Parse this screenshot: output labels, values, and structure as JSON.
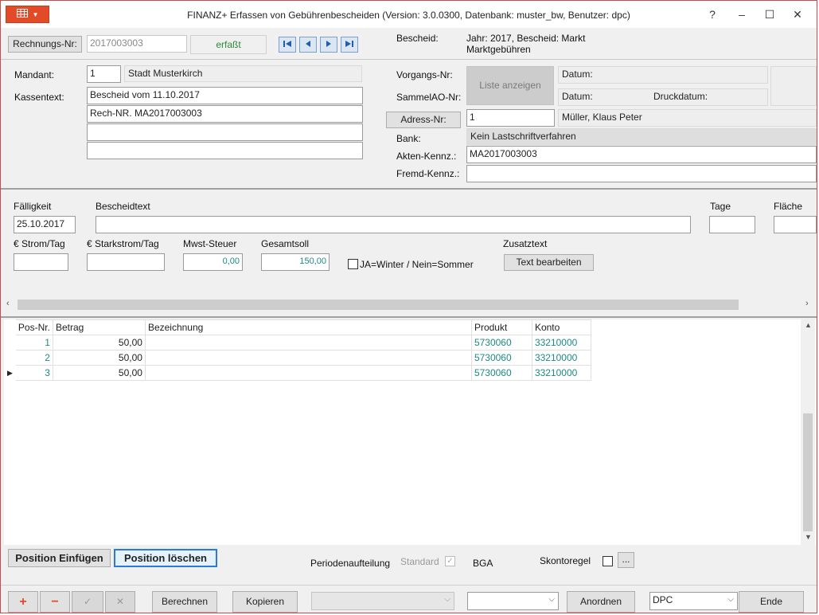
{
  "window": {
    "title": "FINANZ+ Erfassen von Gebührenbescheiden (Version: 3.0.0300, Datenbank: muster_bw, Benutzer: dpc)",
    "help": "?",
    "minimize": "–",
    "maximize": "☐",
    "close": "✕"
  },
  "header": {
    "rechnungs_label": "Rechnungs-Nr:",
    "rechnungs_value": "2017003003",
    "status": "erfaßt",
    "bescheid_label": "Bescheid:",
    "bescheid_line1": "Jahr: 2017, Bescheid: Markt",
    "bescheid_line2": "Marktgebühren"
  },
  "form": {
    "mandant_label": "Mandant:",
    "mandant_nr": "1",
    "mandant_name": "Stadt Musterkirch",
    "kassentext_label": "Kassentext:",
    "kassentext": [
      "Bescheid vom 11.10.2017",
      "Rech-NR. MA2017003003",
      "",
      ""
    ],
    "vorgangs_label": "Vorgangs-Nr:",
    "sammel_label": "SammelAO-Nr:",
    "liste_button": "Liste anzeigen",
    "datum1_label": "Datum:",
    "datum2_label": "Datum:",
    "druckdatum_label": "Druckdatum:",
    "adress_button": "Adress-Nr:",
    "adress_nr": "1",
    "adress_name": "Müller, Klaus Peter",
    "bank_label": "Bank:",
    "bank_value": "Kein Lastschriftverfahren",
    "akten_label": "Akten-Kennz.:",
    "akten_value": "MA2017003003",
    "fremd_label": "Fremd-Kennz.:",
    "fremd_value": ""
  },
  "details": {
    "faelligkeit_label": "Fälligkeit",
    "faelligkeit_value": "25.10.2017",
    "bescheidtext_label": "Bescheidtext",
    "bescheidtext_value": "",
    "tage_label": "Tage",
    "flaeche_label": "Fläche",
    "strom_label": "€ Strom/Tag",
    "starkstrom_label": "€ Starkstrom/Tag",
    "mwst_label": "Mwst-Steuer",
    "mwst_value": "0,00",
    "gesamtsoll_label": "Gesamtsoll",
    "gesamtsoll_value": "150,00",
    "winter_label": "JA=Winter / Nein=Sommer",
    "zusatztext_label": "Zusatztext",
    "text_bearbeiten": "Text bearbeiten"
  },
  "table": {
    "columns": [
      "Pos-Nr.",
      "Betrag",
      "Bezeichnung",
      "Produkt",
      "Konto"
    ],
    "rows": [
      {
        "pos": "1",
        "betrag": "50,00",
        "bezeichnung": "",
        "produkt": "5730060",
        "konto": "33210000"
      },
      {
        "pos": "2",
        "betrag": "50,00",
        "bezeichnung": "",
        "produkt": "5730060",
        "konto": "33210000"
      },
      {
        "pos": "3",
        "betrag": "50,00",
        "bezeichnung": "",
        "produkt": "5730060",
        "konto": "33210000"
      }
    ]
  },
  "footer": {
    "einfuegen": "Position Einfügen",
    "loeschen": "Position löschen",
    "periodenaufteilung": "Periodenaufteilung",
    "standard": "Standard",
    "bga": "BGA",
    "skontoregel": "Skontoregel",
    "dots": "...",
    "plus": "+",
    "minus": "−",
    "check": "✓",
    "cancel": "✕",
    "berechnen": "Berechnen",
    "kopieren": "Kopieren",
    "anordnen": "Anordnen",
    "user_select": "DPC",
    "ende": "Ende"
  },
  "colors": {
    "accent": "#e34a27",
    "status_green": "#2a8a3a",
    "teal": "#1c8a84"
  }
}
